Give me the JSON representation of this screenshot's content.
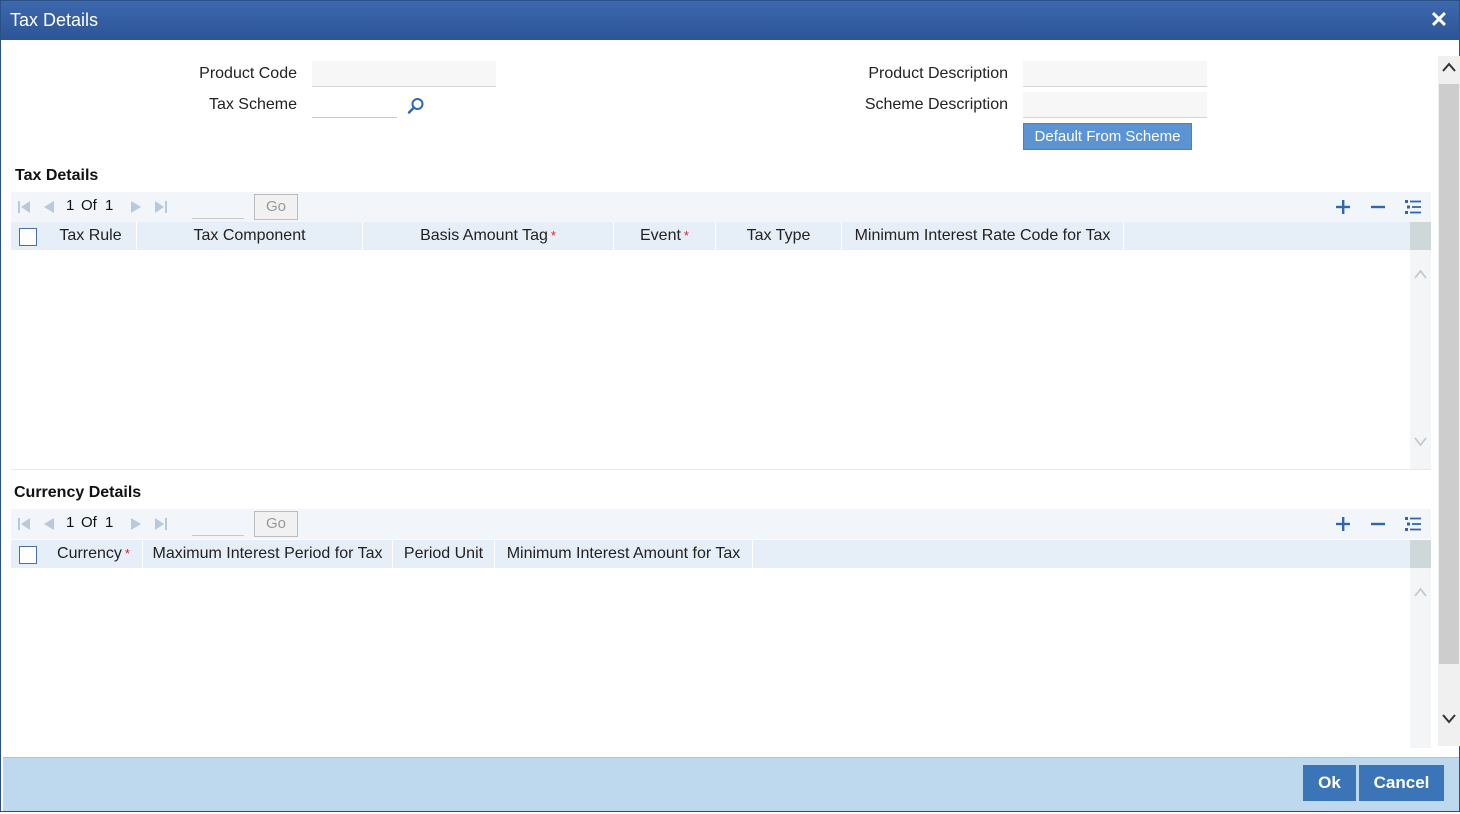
{
  "window": {
    "title": "Tax Details",
    "close_glyph": "✕"
  },
  "form": {
    "product_code": {
      "label": "Product Code",
      "value": ""
    },
    "tax_scheme": {
      "label": "Tax Scheme",
      "value": ""
    },
    "product_description": {
      "label": "Product Description",
      "value": ""
    },
    "scheme_description": {
      "label": "Scheme Description",
      "value": ""
    },
    "default_button": "Default From Scheme"
  },
  "tax_details": {
    "title": "Tax Details",
    "pager": {
      "current": "1",
      "of": "Of",
      "total": "1",
      "go": "Go",
      "go_value": ""
    },
    "columns": [
      {
        "label": "Tax Rule",
        "required": false
      },
      {
        "label": "Tax Component",
        "required": false
      },
      {
        "label": "Basis Amount Tag",
        "required": true
      },
      {
        "label": "Event",
        "required": true
      },
      {
        "label": "Tax Type",
        "required": false
      },
      {
        "label": "Minimum Interest Rate Code for Tax",
        "required": false
      }
    ],
    "rows": []
  },
  "currency_details": {
    "title": "Currency Details",
    "pager": {
      "current": "1",
      "of": "Of",
      "total": "1",
      "go": "Go",
      "go_value": ""
    },
    "columns": [
      {
        "label": "Currency",
        "required": true
      },
      {
        "label": "Maximum Interest Period for Tax",
        "required": false
      },
      {
        "label": "Period Unit",
        "required": false
      },
      {
        "label": "Minimum Interest Amount for Tax",
        "required": false
      }
    ],
    "rows": []
  },
  "required_marker": "*",
  "footer": {
    "ok": "Ok",
    "cancel": "Cancel"
  },
  "colors": {
    "titlebar": "#2c5597",
    "accent": "#3b75b8",
    "footer": "#bed8ee",
    "grid_header": "#e6eef8",
    "required": "#e0201c"
  }
}
